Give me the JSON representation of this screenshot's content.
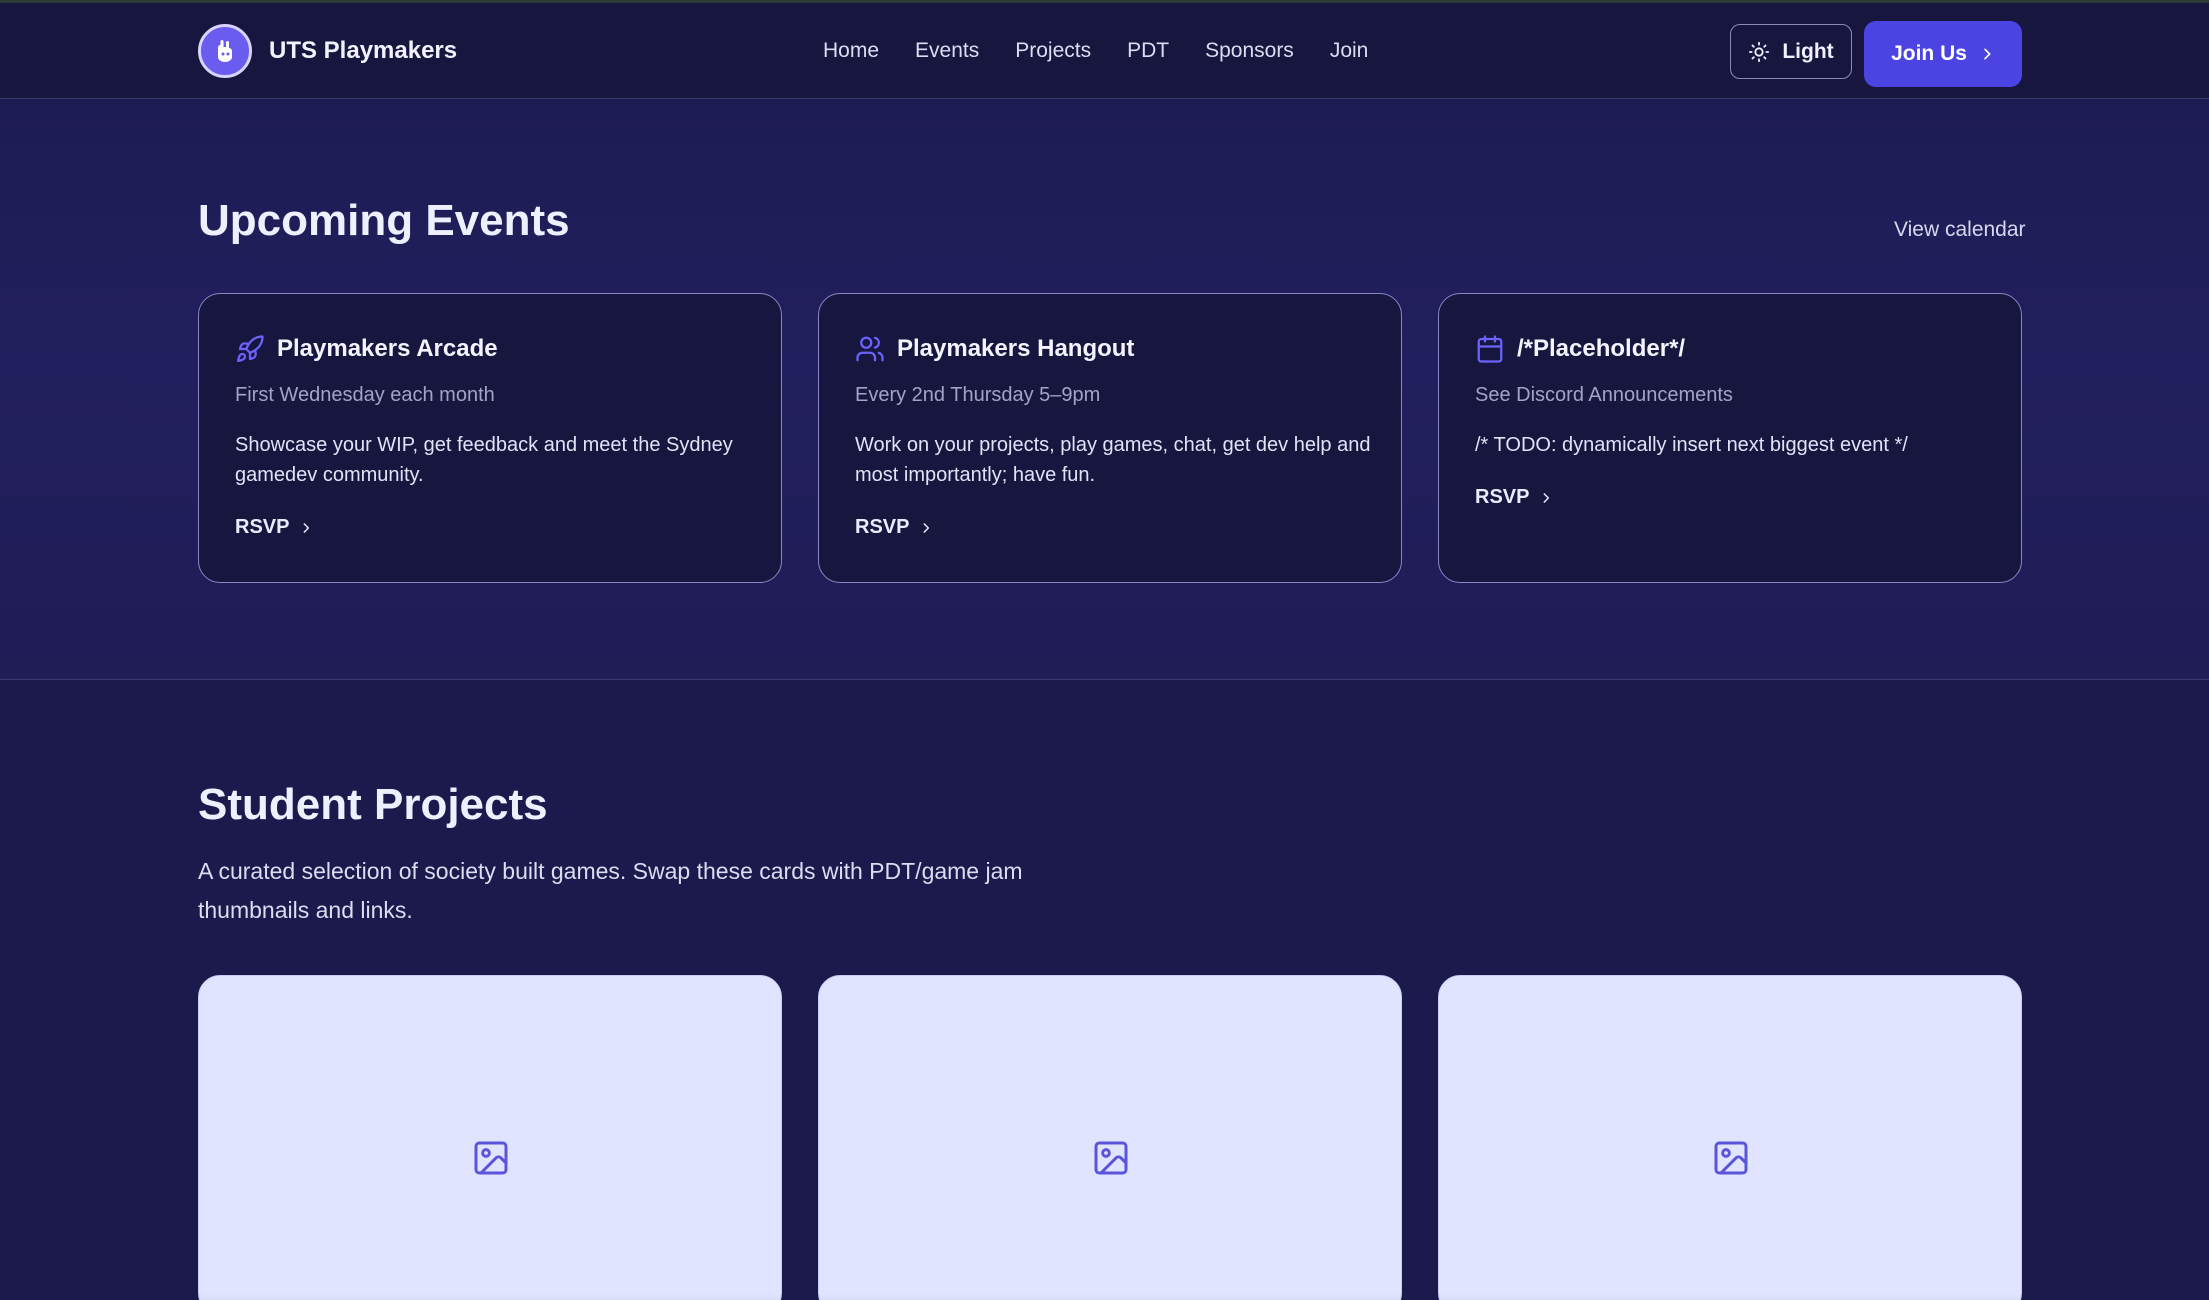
{
  "header": {
    "brand": "UTS Playmakers",
    "nav": [
      "Home",
      "Events",
      "Projects",
      "PDT",
      "Sponsors",
      "Join"
    ],
    "theme_label": "Light",
    "join_label": "Join Us"
  },
  "events": {
    "title": "Upcoming Events",
    "view_calendar": "View calendar",
    "cards": [
      {
        "icon": "rocket-icon",
        "title": "Playmakers Arcade",
        "schedule": "First Wednesday each month",
        "description": "Showcase your WIP, get feedback and meet the Sydney gamedev community.",
        "cta": "RSVP"
      },
      {
        "icon": "users-icon",
        "title": "Playmakers Hangout",
        "schedule": "Every 2nd Thursday 5–9pm",
        "description": "Work on your projects, play games, chat, get dev help and most importantly; have fun.",
        "cta": "RSVP"
      },
      {
        "icon": "calendar-icon",
        "title": "/*Placeholder*/",
        "schedule": "See Discord Announcements",
        "description": "/* TODO: dynamically insert next biggest event */",
        "cta": "RSVP"
      }
    ]
  },
  "projects": {
    "title": "Student Projects",
    "description": "A curated selection of society built games. Swap these cards with PDT/game jam thumbnails and links.",
    "cards": [
      {
        "icon": "image-icon"
      },
      {
        "icon": "image-icon"
      },
      {
        "icon": "image-icon"
      }
    ]
  },
  "colors": {
    "background": "#1c1a4c",
    "card": "#17163f",
    "accent": "#4b44e3",
    "icon_accent": "#6c63ff",
    "project_card": "#e0e4ff"
  }
}
